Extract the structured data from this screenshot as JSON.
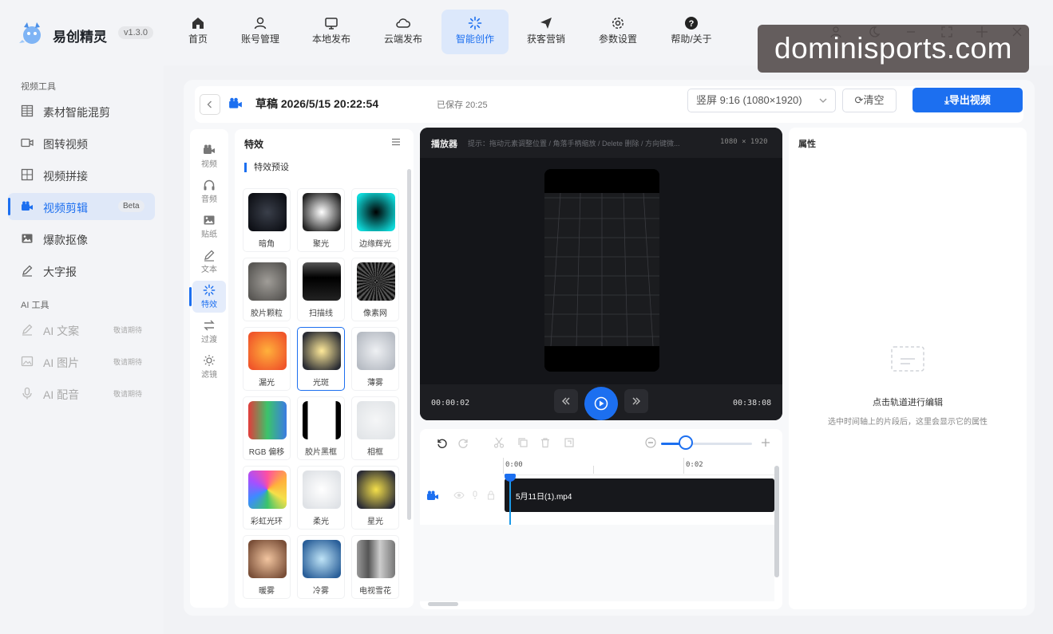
{
  "app": {
    "name": "易创精灵",
    "version": "v1.3.0"
  },
  "nav": [
    {
      "label": "首页",
      "icon": "home-icon"
    },
    {
      "label": "账号管理",
      "icon": "user-icon"
    },
    {
      "label": "本地发布",
      "icon": "monitor-icon"
    },
    {
      "label": "云端发布",
      "icon": "cloud-icon"
    },
    {
      "label": "智能创作",
      "icon": "sparkle-icon",
      "active": true
    },
    {
      "label": "获客营销",
      "icon": "send-icon"
    },
    {
      "label": "参数设置",
      "icon": "gear-icon"
    },
    {
      "label": "帮助/关于",
      "icon": "help-icon"
    }
  ],
  "watermark": "dominisports.com",
  "sidebar": {
    "section1": "视频工具",
    "items": [
      {
        "label": "素材智能混剪",
        "icon": "grid-icon"
      },
      {
        "label": "图转视频",
        "icon": "video-icon"
      },
      {
        "label": "视频拼接",
        "icon": "grid-icon"
      },
      {
        "label": "视频剪辑",
        "icon": "camera-icon",
        "badge": "Beta",
        "active": true
      },
      {
        "label": "爆款抠像",
        "icon": "image-icon"
      },
      {
        "label": "大字报",
        "icon": "pen-icon"
      }
    ],
    "section2": "AI 工具",
    "ai_items": [
      {
        "label": "AI 文案",
        "tag": "敬请期待",
        "icon": "pen-icon"
      },
      {
        "label": "AI 图片",
        "tag": "敬请期待",
        "icon": "image-icon"
      },
      {
        "label": "AI 配音",
        "tag": "敬请期待",
        "icon": "mic-icon"
      }
    ]
  },
  "toolbar": {
    "title": "草稿 2026/5/15 20:22:54",
    "saved": "已保存 20:25",
    "ratio": "竖屏 9:16 (1080×1920)",
    "clear": "清空",
    "export": "导出视频"
  },
  "tools": [
    {
      "label": "视频",
      "icon": "camera-icon"
    },
    {
      "label": "音频",
      "icon": "headphones-icon"
    },
    {
      "label": "贴纸",
      "icon": "image-icon"
    },
    {
      "label": "文本",
      "icon": "pen-icon"
    },
    {
      "label": "特效",
      "icon": "sparkle-icon",
      "active": true
    },
    {
      "label": "过渡",
      "icon": "transition-icon"
    },
    {
      "label": "滤镜",
      "icon": "sun-icon"
    }
  ],
  "effects": {
    "title": "特效",
    "subtitle": "特效预设",
    "items": [
      {
        "name": "暗角",
        "colors": [
          "#3a3f4a",
          "#0e1016"
        ]
      },
      {
        "name": "聚光",
        "colors": [
          "#ffffff",
          "#222222"
        ]
      },
      {
        "name": "边缘辉光",
        "colors": [
          "#000000",
          "#0ed9d9"
        ]
      },
      {
        "name": "胶片颗粒",
        "colors": [
          "#a09d98",
          "#595754"
        ]
      },
      {
        "name": "扫描线",
        "colors": [
          "#3a3a3a",
          "#000000"
        ]
      },
      {
        "name": "像素网",
        "colors": [
          "#555555",
          "#111111"
        ]
      },
      {
        "name": "漏光",
        "colors": [
          "#ffb13b",
          "#f0562a"
        ]
      },
      {
        "name": "光斑",
        "colors": [
          "#ffea9a",
          "#2a2c33"
        ],
        "selected": true
      },
      {
        "name": "薄雾",
        "colors": [
          "#eef0f3",
          "#b7bcc4"
        ]
      },
      {
        "name": "RGB 偏移",
        "colors": [
          "#e33b3b",
          "#3b7be3"
        ]
      },
      {
        "name": "胶片黑框",
        "colors": [
          "#ffffff",
          "#000000"
        ]
      },
      {
        "name": "相框",
        "colors": [
          "#f5f6f7",
          "#e2e5e8"
        ]
      },
      {
        "name": "彩虹光环",
        "colors": [
          "#ff4fa0",
          "#3d8bff"
        ]
      },
      {
        "name": "柔光",
        "colors": [
          "#ffffff",
          "#dfe2e6"
        ]
      },
      {
        "name": "星光",
        "colors": [
          "#f5e04a",
          "#2b2c35"
        ]
      },
      {
        "name": "暖雾",
        "colors": [
          "#f2c5a0",
          "#7a4f38"
        ]
      },
      {
        "name": "冷雾",
        "colors": [
          "#bfe4f7",
          "#2a5f99"
        ]
      },
      {
        "name": "电视雪花",
        "colors": [
          "#bdbdbd",
          "#555555"
        ]
      }
    ]
  },
  "player": {
    "title": "播放器",
    "tip": "提示：拖动元素调整位置 / 角落手柄缩放 / Delete 删除 / 方向键微...",
    "resolution": "1080 × 1920",
    "current": "00:00:02",
    "total": "00:38:08"
  },
  "timeline": {
    "ruler": [
      "0:00",
      "0:02"
    ],
    "clip": "5月11日(1).mp4"
  },
  "properties": {
    "title": "属性",
    "empty_title": "点击轨道进行编辑",
    "empty_sub": "选中时间轴上的片段后，这里会显示它的属性"
  }
}
